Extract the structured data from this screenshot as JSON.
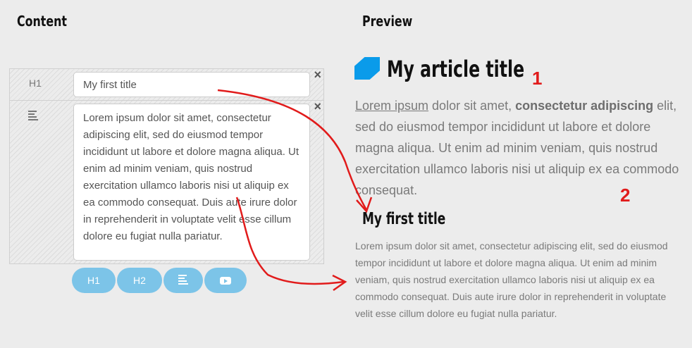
{
  "headings": {
    "content": "Content",
    "preview": "Preview"
  },
  "editor": {
    "blocks": [
      {
        "label": "H1",
        "value": "My first title",
        "close": "×"
      },
      {
        "icon": "paragraph-icon",
        "value": "Lorem ipsum dolor sit amet, consectetur adipiscing elit, sed do eiusmod tempor incididunt ut labore et dolore magna aliqua. Ut enim ad minim veniam, quis nostrud exercitation ullamco laboris nisi ut aliquip ex ea commodo consequat. Duis aute irure dolor in reprehenderit in voluptate velit esse cillum dolore eu fugiat nulla pariatur.",
        "close": "×"
      }
    ],
    "toolbar": [
      {
        "label": "H1"
      },
      {
        "label": "H2"
      },
      {
        "icon": "paragraph-icon"
      },
      {
        "icon": "video-icon"
      }
    ]
  },
  "preview": {
    "title": "My article title",
    "intro": {
      "link": "Lorem ipsum",
      "part1": " dolor sit amet, ",
      "bold": "consectetur adipiscing",
      "part2": " elit, sed do eiusmod tempor incididunt ut labore et dolore magna aliqua. Ut enim ad minim veniam, quis nostrud exercitation ullamco laboris nisi ut aliquip ex ea commodo consequat."
    },
    "block_title": "My first title",
    "block_text": "Lorem ipsum dolor sit amet, consectetur adipiscing elit, sed do eiusmod tempor incididunt ut labore et dolore magna aliqua. Ut enim ad minim veniam, quis nostrud exercitation ullamco laboris nisi ut aliquip ex ea commodo consequat. Duis aute irure dolor in reprehenderit in voluptate velit esse cillum dolore eu fugiat nulla pariatur."
  },
  "annotations": [
    "1",
    "2"
  ],
  "colors": {
    "accent": "#7cc4e8",
    "logo": "#0a9bea",
    "annotation": "#e11b1b"
  }
}
